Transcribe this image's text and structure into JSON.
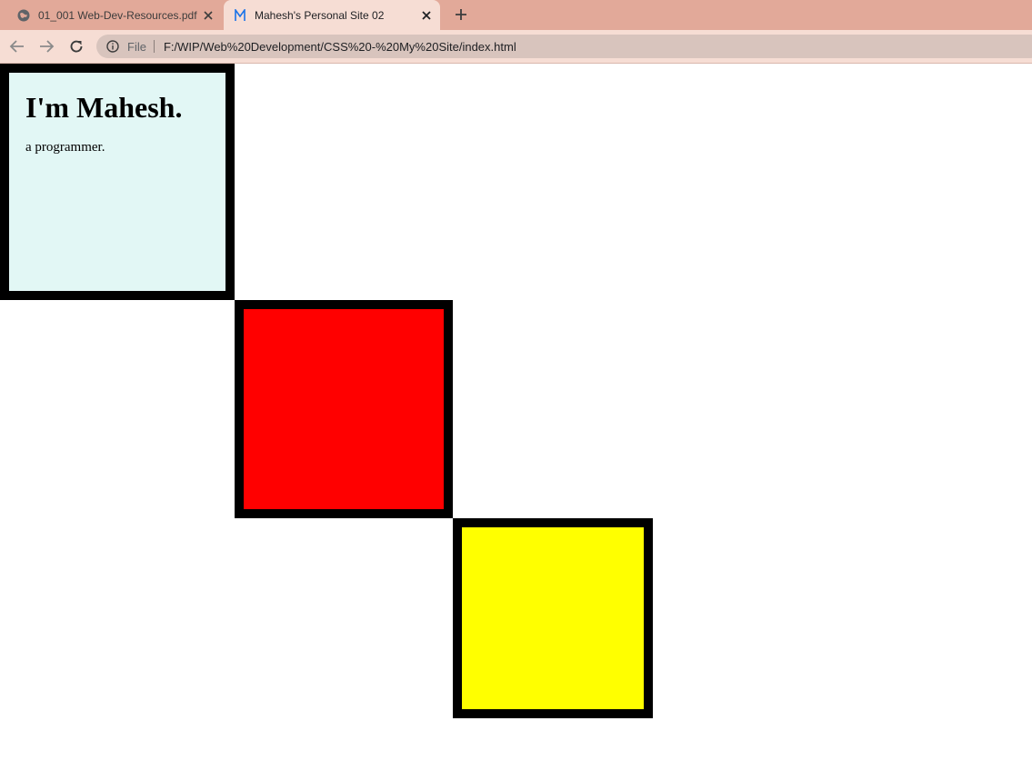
{
  "browser": {
    "tabs": [
      {
        "title": "01_001 Web-Dev-Resources.pdf",
        "icon": "globe-icon",
        "active": false
      },
      {
        "title": "Mahesh's Personal Site 02",
        "icon": "m-logo-icon",
        "active": true
      }
    ],
    "address_bar": {
      "scheme_label": "File",
      "url": "F:/WIP/Web%20Development/CSS%20-%20My%20Site/index.html"
    },
    "colors": {
      "tabbar": "#e2a999",
      "toolbar": "#f6ddd4"
    }
  },
  "page": {
    "heading": "I'm Mahesh.",
    "subtitle": "a programmer.",
    "boxes": [
      {
        "name": "intro",
        "color": "#e2f7f5"
      },
      {
        "name": "red",
        "color": "#ff0000"
      },
      {
        "name": "yellow",
        "color": "#ffff00"
      }
    ],
    "border_color": "#000000"
  }
}
